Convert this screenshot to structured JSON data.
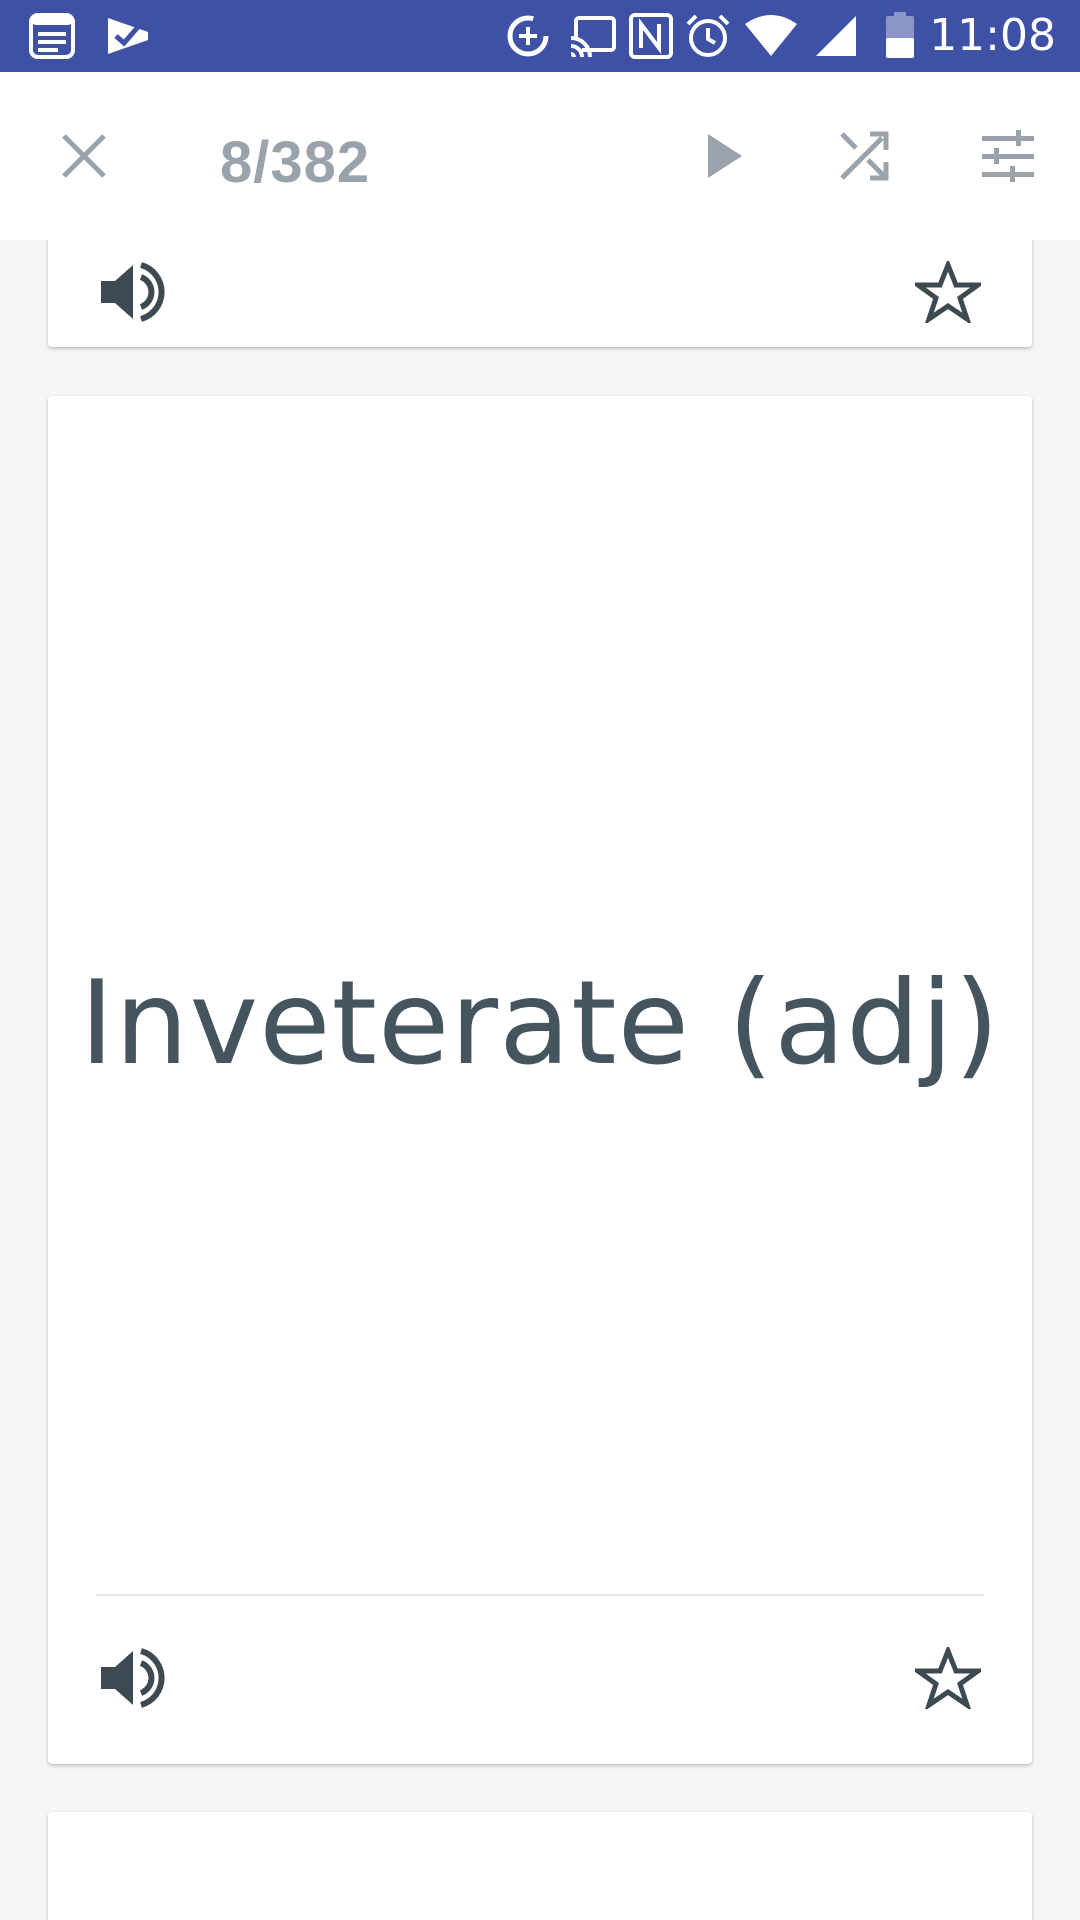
{
  "status_bar": {
    "time": "11:08",
    "icons": [
      "notes-app-icon",
      "tasks-check-icon",
      "data-saver-icon",
      "cast-icon",
      "nfc-icon",
      "alarm-icon",
      "wifi-icon",
      "signal-icon",
      "battery-icon"
    ],
    "background_color": "#3f51a5"
  },
  "toolbar": {
    "counter": "8/382",
    "icons": [
      "close-icon",
      "play-icon",
      "shuffle-icon",
      "settings-sliders-icon"
    ],
    "icon_color": "#9aa3ab"
  },
  "current_card": {
    "term": "Inveterate (adj)",
    "text_color": "#455560"
  }
}
